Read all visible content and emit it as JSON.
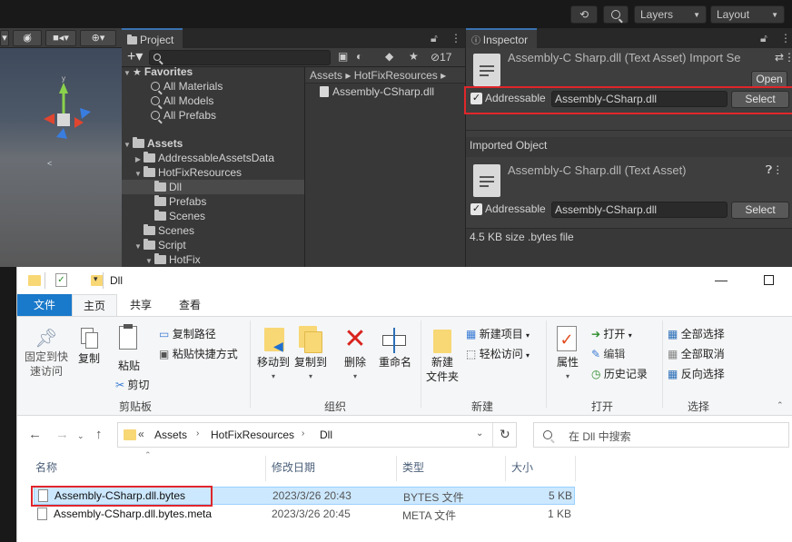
{
  "unity": {
    "toolbar": {
      "layers": "Layers",
      "layout": "Layout"
    },
    "project": {
      "tab": "Project",
      "hidden_count": "17",
      "favorites": {
        "label": "Favorites",
        "items": [
          "All Materials",
          "All Models",
          "All Prefabs"
        ]
      },
      "assets_label": "Assets",
      "tree": [
        {
          "label": "AddressableAssetsData",
          "indent": 2,
          "tri": "▶"
        },
        {
          "label": "HotFixResources",
          "indent": 2,
          "tri": "▼"
        },
        {
          "label": "Dll",
          "indent": 3,
          "tri": "",
          "selected": true
        },
        {
          "label": "Prefabs",
          "indent": 3,
          "tri": ""
        },
        {
          "label": "Scenes",
          "indent": 3,
          "tri": ""
        },
        {
          "label": "Scenes",
          "indent": 2,
          "tri": ""
        },
        {
          "label": "Script",
          "indent": 2,
          "tri": "▼"
        },
        {
          "label": "HotFix",
          "indent": 3,
          "tri": "▼"
        }
      ],
      "breadcrumb": [
        "Assets",
        "HotFixResources"
      ],
      "file": "Assembly-CSharp.dll"
    },
    "inspector": {
      "tab": "Inspector",
      "title": "Assembly-C Sharp.dll (Text Asset) Import Se",
      "open_label": "Open",
      "addressable_label": "Addressable",
      "addressable_value": "Assembly-CSharp.dll",
      "select_label": "Select",
      "imported_object": "Imported Object",
      "asset_title": "Assembly-C Sharp.dll (Text Asset)",
      "addressable_value2": "Assembly-CSharp.dll",
      "select_label2": "Select",
      "size_info": "4.5 KB size .bytes file"
    }
  },
  "explorer": {
    "title": "Dll",
    "tabs": {
      "file": "文件",
      "home": "主页",
      "share": "共享",
      "view": "查看"
    },
    "ribbon": {
      "pin": [
        "固定到快",
        "速访问"
      ],
      "copy": "复制",
      "paste": "粘贴",
      "copy_path": "复制路径",
      "paste_shortcut": "粘贴快捷方式",
      "cut": "剪切",
      "clipboard": "剪贴板",
      "move_to": "移动到",
      "copy_to": "复制到",
      "delete": "删除",
      "rename": "重命名",
      "organize": "组织",
      "new_folder": [
        "新建",
        "文件夹"
      ],
      "new_item": "新建项目",
      "easy_access": "轻松访问",
      "new": "新建",
      "properties": "属性",
      "open": "打开",
      "edit": "编辑",
      "history": "历史记录",
      "open_group": "打开",
      "select_all": "全部选择",
      "select_none": "全部取消",
      "invert": "反向选择",
      "select_group": "选择"
    },
    "address": {
      "prefix": "«",
      "parts": [
        "Assets",
        "HotFixResources",
        "Dll"
      ]
    },
    "search_placeholder": "在 Dll 中搜索",
    "columns": {
      "name": "名称",
      "date": "修改日期",
      "type": "类型",
      "size": "大小"
    },
    "rows": [
      {
        "name": "Assembly-CSharp.dll.bytes",
        "date": "2023/3/26 20:43",
        "type": "BYTES 文件",
        "size": "5 KB",
        "selected": true
      },
      {
        "name": "Assembly-CSharp.dll.bytes.meta",
        "date": "2023/3/26 20:45",
        "type": "META 文件",
        "size": "1 KB",
        "selected": false
      }
    ]
  }
}
